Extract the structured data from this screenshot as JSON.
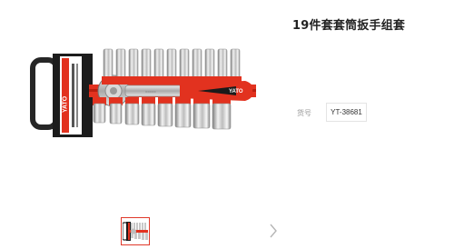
{
  "product": {
    "title": "19件套套筒扳手组套",
    "model_label": "货号",
    "model_value": "YT-38681",
    "image_alt": "YATO 19件套套筒扳手组套 产品图"
  },
  "brand": {
    "logo_text": "YATO",
    "red": "#e2321f",
    "dark": "#1a1a1a"
  },
  "gallery": {
    "thumbnails": [
      {
        "name": "socket-set-thumbnail",
        "selected": true
      }
    ],
    "next_icon": "chevron-right-icon"
  }
}
